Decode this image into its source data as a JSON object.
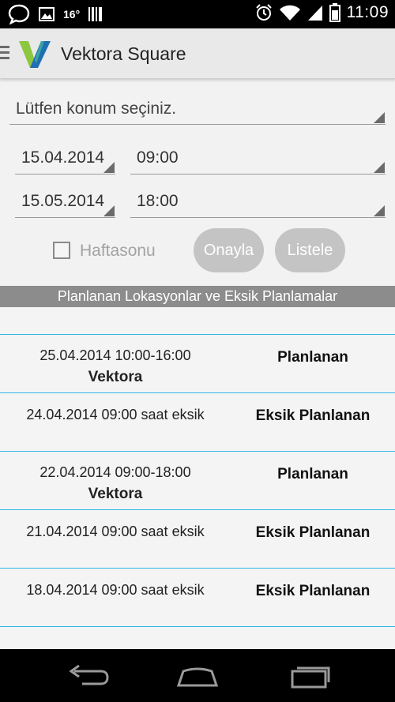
{
  "status_bar": {
    "temperature": "16°",
    "time": "11:09",
    "icons": [
      "chat-bubble-icon",
      "image-icon",
      "barcode-icon",
      "alarm-icon",
      "wifi-icon",
      "signal-icon",
      "battery-icon"
    ]
  },
  "app": {
    "title": "Vektora Square",
    "accent_colors": {
      "logo_green": "#8dc63f",
      "logo_blue": "#1f6fb5",
      "divider_blue": "#33b5e5"
    }
  },
  "form": {
    "location_placeholder": "Lütfen konum seçiniz.",
    "start_date": "15.04.2014",
    "start_time": "09:00",
    "end_date": "15.05.2014",
    "end_time": "18:00",
    "weekend_label": "Haftasonu",
    "weekend_checked": false,
    "approve_label": "Onayla",
    "list_label": "Listele"
  },
  "list": {
    "header": "Planlanan Lokasyonlar ve Eksik Planlamalar",
    "rows": [
      {
        "left": "25.04.2014 10:00-16:00",
        "sub": "Vektora",
        "right": "Planlanan"
      },
      {
        "left": "24.04.2014 09:00 saat eksik",
        "sub": "",
        "right": "Eksik Planlanan"
      },
      {
        "left": "22.04.2014 09:00-18:00",
        "sub": "Vektora",
        "right": "Planlanan"
      },
      {
        "left": "21.04.2014 09:00 saat eksik",
        "sub": "",
        "right": "Eksik Planlanan"
      },
      {
        "left": "18.04.2014 09:00 saat eksik",
        "sub": "",
        "right": "Eksik Planlanan"
      }
    ]
  },
  "nav": {
    "buttons": [
      "back-icon",
      "home-icon",
      "recent-apps-icon"
    ]
  }
}
